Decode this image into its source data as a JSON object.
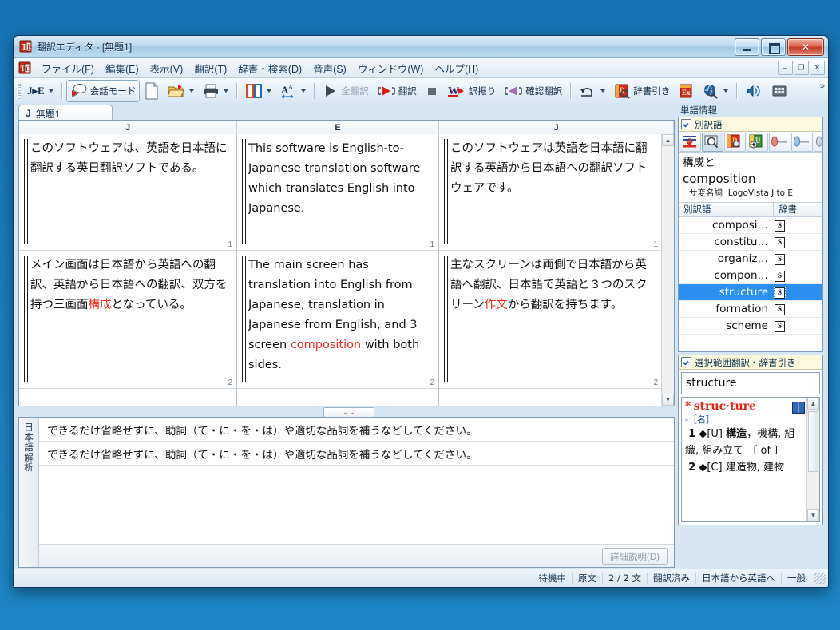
{
  "window": {
    "title": "翻訳エディタ - [無題1]",
    "app_icon": "translation-editor-icon",
    "minimize": "–",
    "maximize": "□",
    "close": "✕"
  },
  "menubar": {
    "icon": "document-icon",
    "items": [
      {
        "label": "ファイル(F)"
      },
      {
        "label": "編集(E)"
      },
      {
        "label": "表示(V)"
      },
      {
        "label": "翻訳(T)"
      },
      {
        "label": "辞書・検索(D)"
      },
      {
        "label": "音声(S)"
      },
      {
        "label": "ウィンドウ(W)"
      },
      {
        "label": "ヘルプ(H)"
      }
    ],
    "mdi_minimize": "–",
    "mdi_restore": "❐",
    "mdi_close": "✕"
  },
  "toolbar": {
    "direction_label": "J▸E",
    "conversation_mode": "会話モード",
    "new_doc": "new-document",
    "open_doc": "open-folder",
    "print": "print",
    "layout": "pane-layout",
    "font_size": "font-size",
    "translate_all": "全翻訳",
    "translate": "翻訳",
    "stop": "stop",
    "furigana": "訳振り",
    "confirm_translate": "確認翻訳",
    "undo": "undo",
    "dictionary_lookup": "辞書引き",
    "excel": "excel-lookup",
    "web_search": "web-search",
    "speak": "speak",
    "keypad": "keypad",
    "overflow": "»"
  },
  "document_tab": {
    "marker": "J",
    "name": "無題1"
  },
  "editor": {
    "columns": [
      {
        "label": "J"
      },
      {
        "label": "E"
      },
      {
        "label": "J"
      }
    ],
    "rows": [
      {
        "number": "1",
        "japanese_source": "このソフトウェアは、英語を日本語に翻訳する英日翻訳ソフトである。",
        "english": [
          {
            "t": "This software is English-to-Japanese translation software which translates English into Japanese.",
            "hl": false
          }
        ],
        "japanese_back": [
          {
            "t": "このソフトウェアは英語を日本語に翻訳する英語から日本語への翻訳ソフトウェアです。",
            "hl": false
          }
        ]
      },
      {
        "number": "2",
        "japanese_source_parts": [
          {
            "t": "メイン画面は日本語から英語への翻訳、英語から日本語への翻訳、双方を持つ三画面",
            "hl": false
          },
          {
            "t": "構成",
            "hl": true
          },
          {
            "t": "となっている。",
            "hl": false
          }
        ],
        "english": [
          {
            "t": "The main screen has translation into English from Japanese, translation in Japanese from English, and 3 screen ",
            "hl": false
          },
          {
            "t": "composition",
            "hl": true
          },
          {
            "t": " with both sides.",
            "hl": false
          }
        ],
        "japanese_back": [
          {
            "t": "主なスクリーンは両側で日本語から英語へ翻訳、日本語で英語と３つのスクリーン",
            "hl": false
          },
          {
            "t": "作文",
            "hl": true
          },
          {
            "t": "から翻訳を持ちます。",
            "hl": false
          }
        ]
      }
    ],
    "highlight_color": "#ee2b1e",
    "collapse_chevron": "»",
    "splitter_chevron": "⌄⌄"
  },
  "analysis": {
    "side_label": "日本語解析",
    "rows": [
      {
        "text": "できるだけ省略せずに、助詞（て・に・を・は）や適切な品詞を補うなどしてください。"
      },
      {
        "text": "できるだけ省略せずに、助詞（て・に・を・は）や適切な品詞を補うなどしてください。"
      }
    ],
    "detail_button": "詳細説明(D)"
  },
  "sidebar": {
    "title": "単語情報",
    "alt_translations": {
      "checkbox_label": "別訳語",
      "checked": true,
      "tools": [
        {
          "name": "insert-word-icon"
        },
        {
          "name": "search-word-icon"
        },
        {
          "name": "dictionary-lookup-icon"
        },
        {
          "name": "add-user-dictionary-icon"
        },
        {
          "name": "slider-red-icon"
        },
        {
          "name": "slider-blue-icon"
        },
        {
          "name": "slider-extra-icon"
        }
      ],
      "headword_japanese": "構成と",
      "headword_english": "composition",
      "pos": "サ変名詞",
      "dictionary_source": "LogoVista J to E",
      "list_headers": {
        "word": "別訳語",
        "dict": "辞書"
      },
      "list": [
        {
          "word": "composi…",
          "dict": "S",
          "selected": false
        },
        {
          "word": "constitu…",
          "dict": "S",
          "selected": false
        },
        {
          "word": "organiz…",
          "dict": "S",
          "selected": false
        },
        {
          "word": "compon…",
          "dict": "S",
          "selected": false
        },
        {
          "word": "structure",
          "dict": "S",
          "selected": true
        },
        {
          "word": "formation",
          "dict": "S",
          "selected": false
        },
        {
          "word": "scheme",
          "dict": "S",
          "selected": false
        }
      ],
      "selection_color": "#2a8fee"
    },
    "selection_lookup": {
      "checkbox_label": "選択範囲翻訳・辞書引き",
      "checked": true,
      "query": "structure",
      "entry": {
        "asterisk": "*",
        "headword": "struc·ture",
        "book_icon": "dictionary-book-icon",
        "pos": "-［名］",
        "senses": [
          {
            "num": "1",
            "marker": "◆",
            "code": "[U]",
            "bold": "構造",
            "rest": "，機構, 組織, 組み立て 〔 of 〕"
          },
          {
            "num": "2",
            "marker": "◆",
            "code": "[C]",
            "bold": "",
            "rest": "建造物, 建物"
          }
        ]
      }
    }
  },
  "statusbar": {
    "cells": [
      {
        "text": "待機中"
      },
      {
        "text": "原文"
      },
      {
        "text": "2 / 2 文"
      },
      {
        "text": "翻訳済み"
      },
      {
        "text": "日本語から英語へ"
      },
      {
        "text": "一般"
      }
    ]
  }
}
